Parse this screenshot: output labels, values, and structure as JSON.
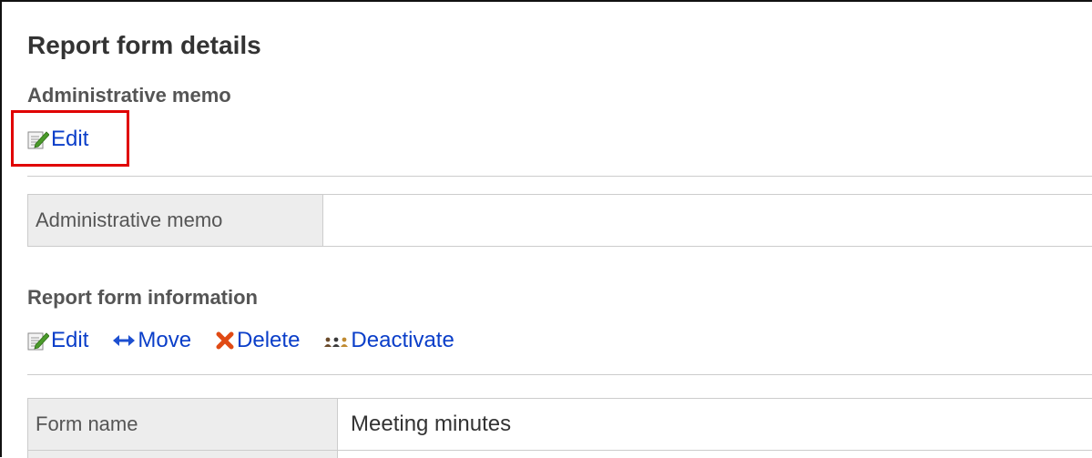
{
  "page": {
    "title": "Report form details"
  },
  "memo_section": {
    "heading": "Administrative memo",
    "edit_label": "Edit",
    "edit_icon": "edit-icon",
    "field_label": "Administrative memo",
    "field_value": ""
  },
  "info_section": {
    "heading": "Report form information",
    "actions": [
      {
        "label": "Edit",
        "icon": "edit-icon"
      },
      {
        "label": "Move",
        "icon": "move-icon"
      },
      {
        "label": "Delete",
        "icon": "delete-icon"
      },
      {
        "label": "Deactivate",
        "icon": "deactivate-icon"
      }
    ],
    "fields": [
      {
        "label": "Form name",
        "value": "Meeting minutes"
      }
    ]
  },
  "colors": {
    "link": "#0a3ec9",
    "highlight_border": "#e00000",
    "label_bg": "#ededed",
    "delete_icon": "#e04a14"
  }
}
